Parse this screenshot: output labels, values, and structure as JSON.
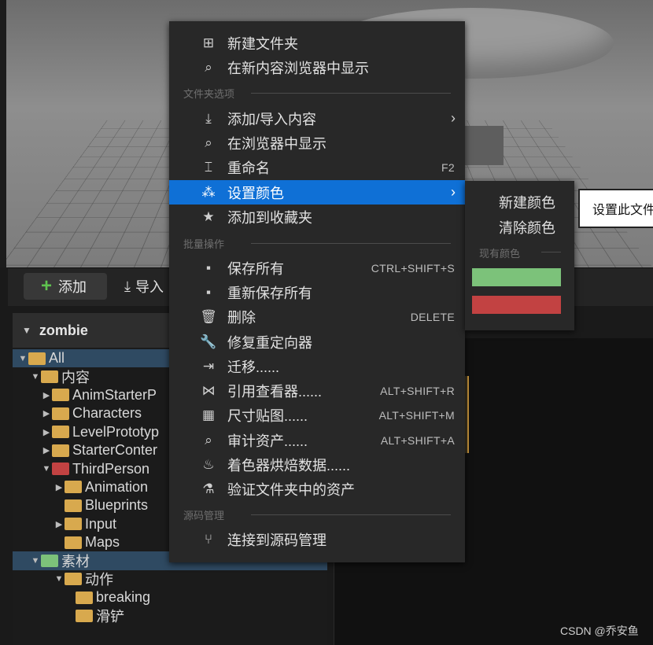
{
  "toolbar": {
    "add_label": "添加",
    "import_label": "导入"
  },
  "panel": {
    "title": "zombie"
  },
  "tree": [
    {
      "label": "All",
      "color": "orange",
      "arrow": "▼",
      "selected": true
    },
    {
      "label": "内容",
      "color": "orange",
      "arrow": "▼"
    },
    {
      "label": "AnimStarterP",
      "color": "orange",
      "arrow": "▶"
    },
    {
      "label": "Characters",
      "color": "orange",
      "arrow": "▶"
    },
    {
      "label": "LevelPrototyp",
      "color": "orange",
      "arrow": "▶"
    },
    {
      "label": "StarterConter",
      "color": "orange",
      "arrow": "▶"
    },
    {
      "label": "ThirdPerson",
      "color": "red",
      "arrow": "▼"
    },
    {
      "label": "Animation",
      "color": "orange",
      "arrow": "▶"
    },
    {
      "label": "Blueprints",
      "color": "orange",
      "arrow": ""
    },
    {
      "label": "Input",
      "color": "orange",
      "arrow": "▶"
    },
    {
      "label": "Maps",
      "color": "orange",
      "arrow": ""
    },
    {
      "label": "素材",
      "color": "green",
      "arrow": "▼",
      "selected": true
    },
    {
      "label": "动作",
      "color": "orange",
      "arrow": "▼"
    },
    {
      "label": "breaking",
      "color": "orange",
      "arrow": ""
    },
    {
      "label": "滑铲",
      "color": "orange",
      "arrow": ""
    }
  ],
  "menu": {
    "items": [
      {
        "icon": "new-folder-icon",
        "glyph": "⊞",
        "label": "新建文件夹"
      },
      {
        "icon": "show-in-new-browser-icon",
        "glyph": "⌕",
        "label": "在新内容浏览器中显示"
      },
      {
        "icon": "add-import-icon",
        "glyph": "⤓",
        "label": "添加/导入内容",
        "submenu": true
      },
      {
        "icon": "show-in-browser-icon",
        "glyph": "⌕",
        "label": "在浏览器中显示"
      },
      {
        "icon": "rename-icon",
        "glyph": "⌶",
        "label": "重命名",
        "shortcut": "F2"
      },
      {
        "icon": "set-color-icon",
        "glyph": "⁂",
        "label": "设置颜色",
        "submenu": true,
        "highlighted": true
      },
      {
        "icon": "star-icon",
        "glyph": "★",
        "label": "添加到收藏夹"
      },
      {
        "icon": "save-icon",
        "glyph": "▪",
        "label": "保存所有",
        "shortcut": "CTRL+SHIFT+S"
      },
      {
        "icon": "resave-icon",
        "glyph": "▪",
        "label": "重新保存所有"
      },
      {
        "icon": "trash-icon",
        "glyph": "🗑",
        "label": "删除",
        "shortcut": "DELETE"
      },
      {
        "icon": "wrench-icon",
        "glyph": "🔧",
        "label": "修复重定向器"
      },
      {
        "icon": "migrate-icon",
        "glyph": "⇥",
        "label": "迁移......"
      },
      {
        "icon": "reference-viewer-icon",
        "glyph": "⋈",
        "label": "引用查看器......",
        "shortcut": "ALT+SHIFT+R"
      },
      {
        "icon": "size-map-icon",
        "glyph": "▦",
        "label": "尺寸贴图......",
        "shortcut": "ALT+SHIFT+M"
      },
      {
        "icon": "audit-icon",
        "glyph": "⌕",
        "label": "审计资产......",
        "shortcut": "ALT+SHIFT+A"
      },
      {
        "icon": "shader-bake-icon",
        "glyph": "♨",
        "label": "着色器烘焙数据......"
      },
      {
        "icon": "flask-icon",
        "glyph": "⚗",
        "label": "验证文件夹中的资产"
      },
      {
        "icon": "source-control-icon",
        "glyph": "⑂",
        "label": "连接到源码管理"
      }
    ],
    "sections": [
      "文件夹选项",
      "批量操作",
      "源码管理"
    ]
  },
  "submenu": {
    "new_color": "新建颜色",
    "clear_color": "清除颜色",
    "existing_colors": "现有颜色",
    "swatches": [
      "#7cc27a",
      "#c24242"
    ]
  },
  "tooltip": {
    "text": "设置此文件"
  },
  "watermark": "CSDN @乔安鱼"
}
